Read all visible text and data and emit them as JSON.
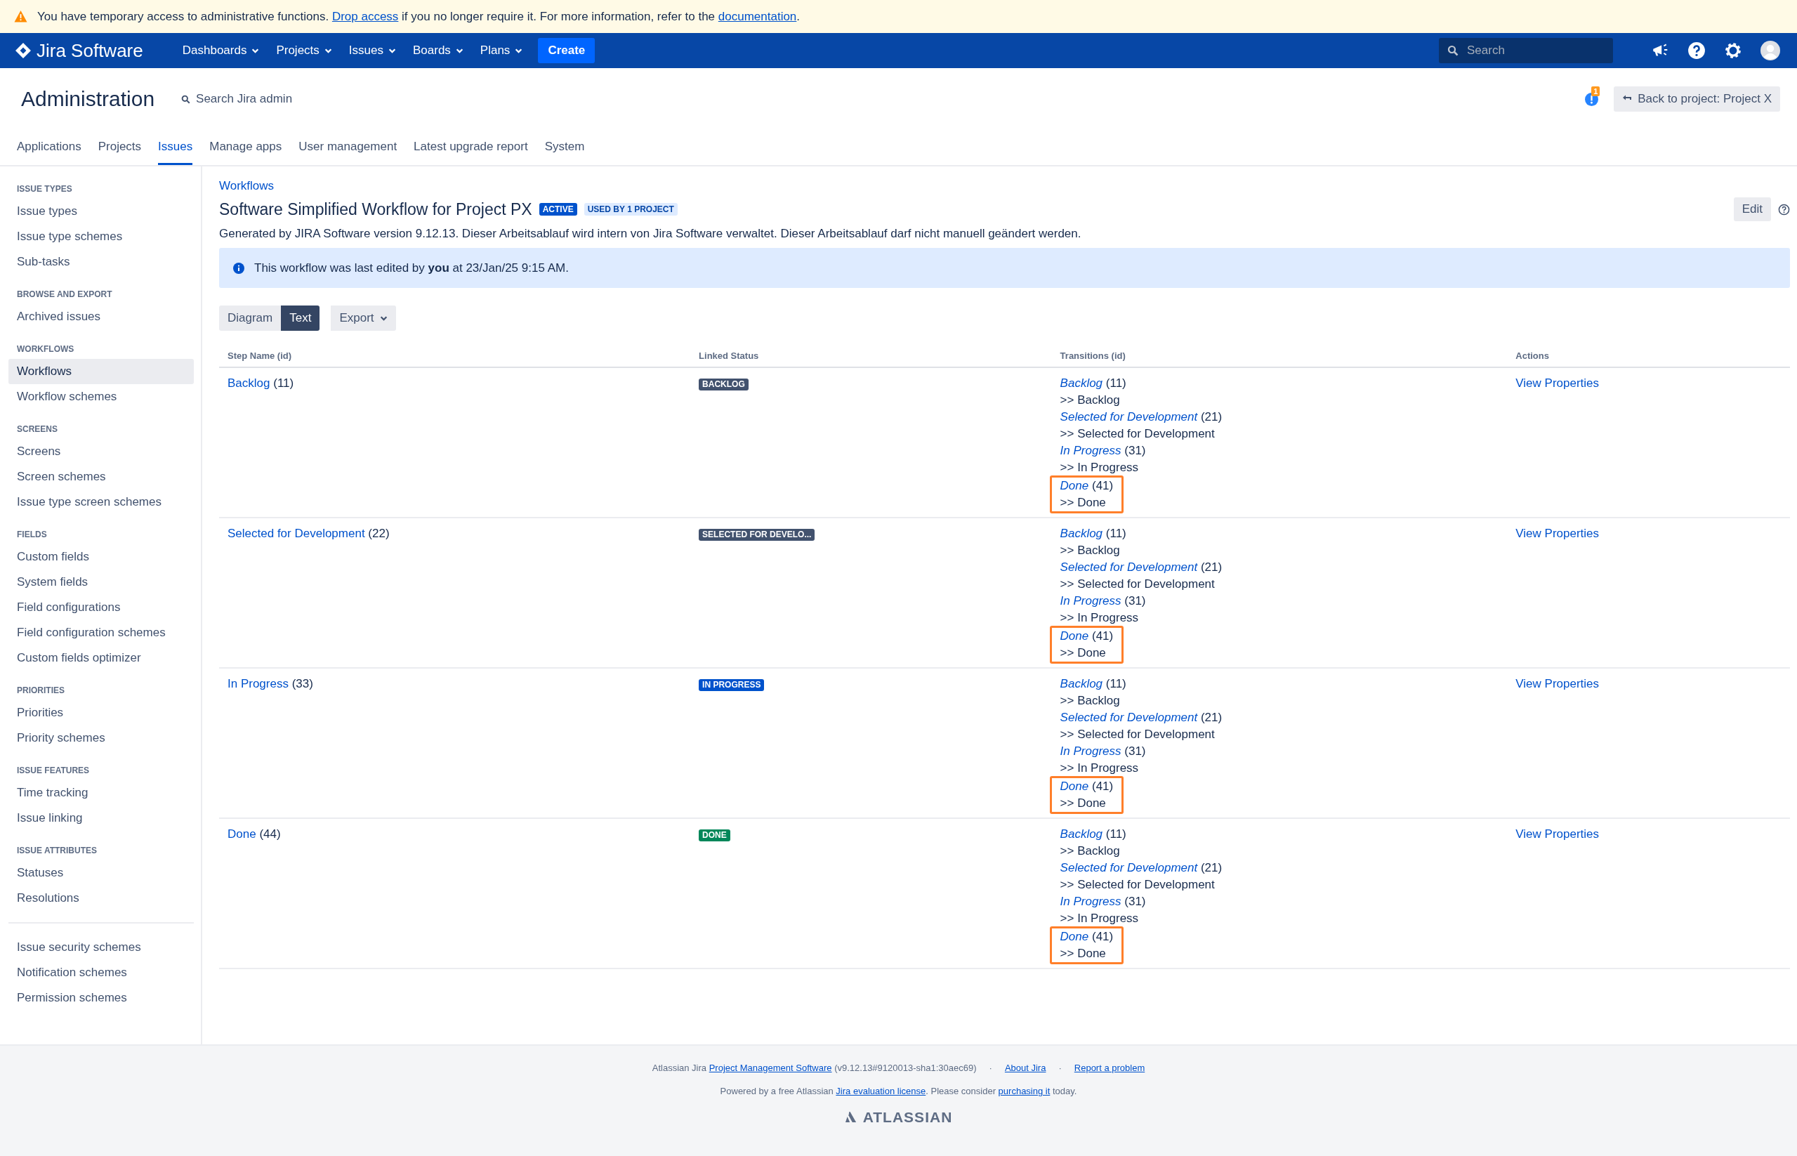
{
  "banner": {
    "segments": [
      {
        "text": "You have temporary access to administrative functions. ",
        "link": false
      },
      {
        "text": "Drop access",
        "link": true
      },
      {
        "text": " if you no longer require it. For more information, refer to the ",
        "link": false
      },
      {
        "text": "documentation",
        "link": true
      },
      {
        "text": ".",
        "link": false
      }
    ]
  },
  "topnav": {
    "logo": "Jira Software",
    "menus": [
      "Dashboards",
      "Projects",
      "Issues",
      "Boards",
      "Plans"
    ],
    "create": "Create",
    "search_placeholder": "Search"
  },
  "admin": {
    "title": "Administration",
    "search": "Search Jira admin",
    "notification_count": "1",
    "back_button": "Back to project: Project X",
    "tabs": [
      {
        "label": "Applications",
        "selected": false
      },
      {
        "label": "Projects",
        "selected": false
      },
      {
        "label": "Issues",
        "selected": true
      },
      {
        "label": "Manage apps",
        "selected": false
      },
      {
        "label": "User management",
        "selected": false
      },
      {
        "label": "Latest upgrade report",
        "selected": false
      },
      {
        "label": "System",
        "selected": false
      }
    ]
  },
  "sidebar": {
    "sections": [
      {
        "heading": "ISSUE TYPES",
        "items": [
          {
            "label": "Issue types",
            "selected": false
          },
          {
            "label": "Issue type schemes",
            "selected": false
          },
          {
            "label": "Sub-tasks",
            "selected": false
          }
        ]
      },
      {
        "heading": "BROWSE AND EXPORT",
        "items": [
          {
            "label": "Archived issues",
            "selected": false
          }
        ]
      },
      {
        "heading": "WORKFLOWS",
        "items": [
          {
            "label": "Workflows",
            "selected": true
          },
          {
            "label": "Workflow schemes",
            "selected": false
          }
        ]
      },
      {
        "heading": "SCREENS",
        "items": [
          {
            "label": "Screens",
            "selected": false
          },
          {
            "label": "Screen schemes",
            "selected": false
          },
          {
            "label": "Issue type screen schemes",
            "selected": false
          }
        ]
      },
      {
        "heading": "FIELDS",
        "items": [
          {
            "label": "Custom fields",
            "selected": false
          },
          {
            "label": "System fields",
            "selected": false
          },
          {
            "label": "Field configurations",
            "selected": false
          },
          {
            "label": "Field configuration schemes",
            "selected": false
          },
          {
            "label": "Custom fields optimizer",
            "selected": false
          }
        ]
      },
      {
        "heading": "PRIORITIES",
        "items": [
          {
            "label": "Priorities",
            "selected": false
          },
          {
            "label": "Priority schemes",
            "selected": false
          }
        ]
      },
      {
        "heading": "ISSUE FEATURES",
        "items": [
          {
            "label": "Time tracking",
            "selected": false
          },
          {
            "label": "Issue linking",
            "selected": false
          }
        ]
      },
      {
        "heading": "ISSUE ATTRIBUTES",
        "items": [
          {
            "label": "Statuses",
            "selected": false
          },
          {
            "label": "Resolutions",
            "selected": false
          }
        ]
      },
      {
        "items": [
          {
            "label": "Issue security schemes",
            "selected": false
          },
          {
            "label": "Notification schemes",
            "selected": false
          },
          {
            "label": "Permission schemes",
            "selected": false
          }
        ]
      }
    ]
  },
  "workflow": {
    "breadcrumb": "Workflows",
    "title": "Software Simplified Workflow for Project PX",
    "badges": [
      {
        "text": "ACTIVE",
        "kind": "active"
      },
      {
        "text": "USED BY 1 PROJECT",
        "kind": "usage"
      }
    ],
    "edit": "Edit",
    "description": "Generated by JIRA Software version 9.12.13. Dieser Arbeitsablauf wird intern von Jira Software verwaltet. Dieser Arbeitsablauf darf nicht manuell geändert werden.",
    "info": "This workflow was last edited by **you** at 23/Jan/25 9:15 AM.",
    "view_toggle": [
      {
        "label": "Diagram",
        "selected": false
      },
      {
        "label": "Text",
        "selected": true
      }
    ],
    "export": "Export",
    "table": {
      "columns": [
        "Step Name (id)",
        "Linked Status",
        "Transitions (id)",
        "Actions"
      ],
      "rows": [
        {
          "step": "Backlog",
          "id": "(11)",
          "status": {
            "text": "BACKLOG",
            "color": "#42526e"
          },
          "transitions": [
            {
              "name": "Backlog",
              "id": "(11)",
              "target": ">> Backlog",
              "highlighted": false
            },
            {
              "name": "Selected for Development",
              "id": "(21)",
              "target": ">> Selected for Development",
              "highlighted": false
            },
            {
              "name": "In Progress",
              "id": "(31)",
              "target": ">> In Progress",
              "highlighted": false
            },
            {
              "name": "Done",
              "id": "(41)",
              "target": ">> Done",
              "highlighted": true
            }
          ],
          "action": "View Properties"
        },
        {
          "step": "Selected for Development",
          "id": "(22)",
          "status": {
            "text": "SELECTED FOR DEVELO...",
            "color": "#42526e"
          },
          "transitions": [
            {
              "name": "Backlog",
              "id": "(11)",
              "target": ">> Backlog",
              "highlighted": false
            },
            {
              "name": "Selected for Development",
              "id": "(21)",
              "target": ">> Selected for Development",
              "highlighted": false
            },
            {
              "name": "In Progress",
              "id": "(31)",
              "target": ">> In Progress",
              "highlighted": false
            },
            {
              "name": "Done",
              "id": "(41)",
              "target": ">> Done",
              "highlighted": true
            }
          ],
          "action": "View Properties"
        },
        {
          "step": "In Progress",
          "id": "(33)",
          "status": {
            "text": "IN PROGRESS",
            "color": "#0052cc"
          },
          "transitions": [
            {
              "name": "Backlog",
              "id": "(11)",
              "target": ">> Backlog",
              "highlighted": false
            },
            {
              "name": "Selected for Development",
              "id": "(21)",
              "target": ">> Selected for Development",
              "highlighted": false
            },
            {
              "name": "In Progress",
              "id": "(31)",
              "target": ">> In Progress",
              "highlighted": false
            },
            {
              "name": "Done",
              "id": "(41)",
              "target": ">> Done",
              "highlighted": true
            }
          ],
          "action": "View Properties"
        },
        {
          "step": "Done",
          "id": "(44)",
          "status": {
            "text": "DONE",
            "color": "#00875a"
          },
          "transitions": [
            {
              "name": "Backlog",
              "id": "(11)",
              "target": ">> Backlog",
              "highlighted": false
            },
            {
              "name": "Selected for Development",
              "id": "(21)",
              "target": ">> Selected for Development",
              "highlighted": false
            },
            {
              "name": "In Progress",
              "id": "(31)",
              "target": ">> In Progress",
              "highlighted": false
            },
            {
              "name": "Done",
              "id": "(41)",
              "target": ">> Done",
              "highlighted": true
            }
          ],
          "action": "View Properties"
        }
      ]
    }
  },
  "footer": {
    "line1": [
      {
        "text": "Atlassian Jira ",
        "link": false
      },
      {
        "text": "Project Management Software",
        "link": true
      },
      {
        "text": " (v9.12.13#9120013-sha1:30aec69)",
        "link": false
      }
    ],
    "links": [
      {
        "separator": "·",
        "text": "About Jira"
      },
      {
        "separator": "·",
        "text": "Report a problem"
      }
    ],
    "line2": [
      {
        "text": "Powered by a free Atlassian ",
        "link": false
      },
      {
        "text": "Jira evaluation license",
        "link": true
      },
      {
        "text": ". Please consider ",
        "link": false
      },
      {
        "text": "purchasing it",
        "link": true
      },
      {
        "text": " today.",
        "link": false
      }
    ],
    "logo": "ATLASSIAN"
  }
}
